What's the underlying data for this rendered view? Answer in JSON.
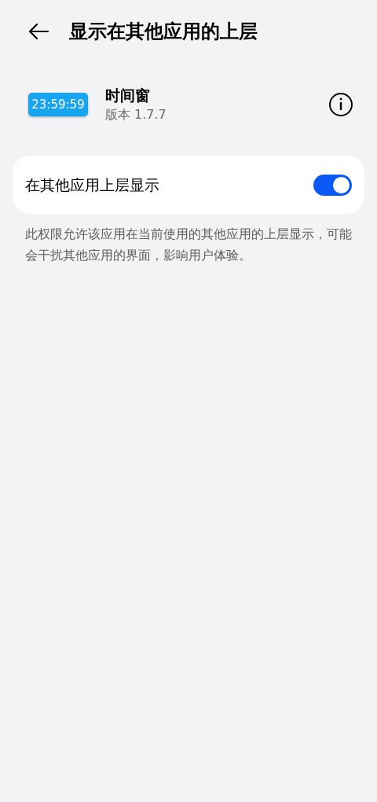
{
  "header": {
    "title": "显示在其他应用的上层"
  },
  "app": {
    "icon_text": "23:59:59",
    "name": "时间窗",
    "version": "版本 1.7.7"
  },
  "setting": {
    "label": "在其他应用上层显示",
    "on": true
  },
  "description": "此权限允许该应用在当前使用的其他应用的上层显示，可能会干扰其他应用的界面，影响用户体验。"
}
